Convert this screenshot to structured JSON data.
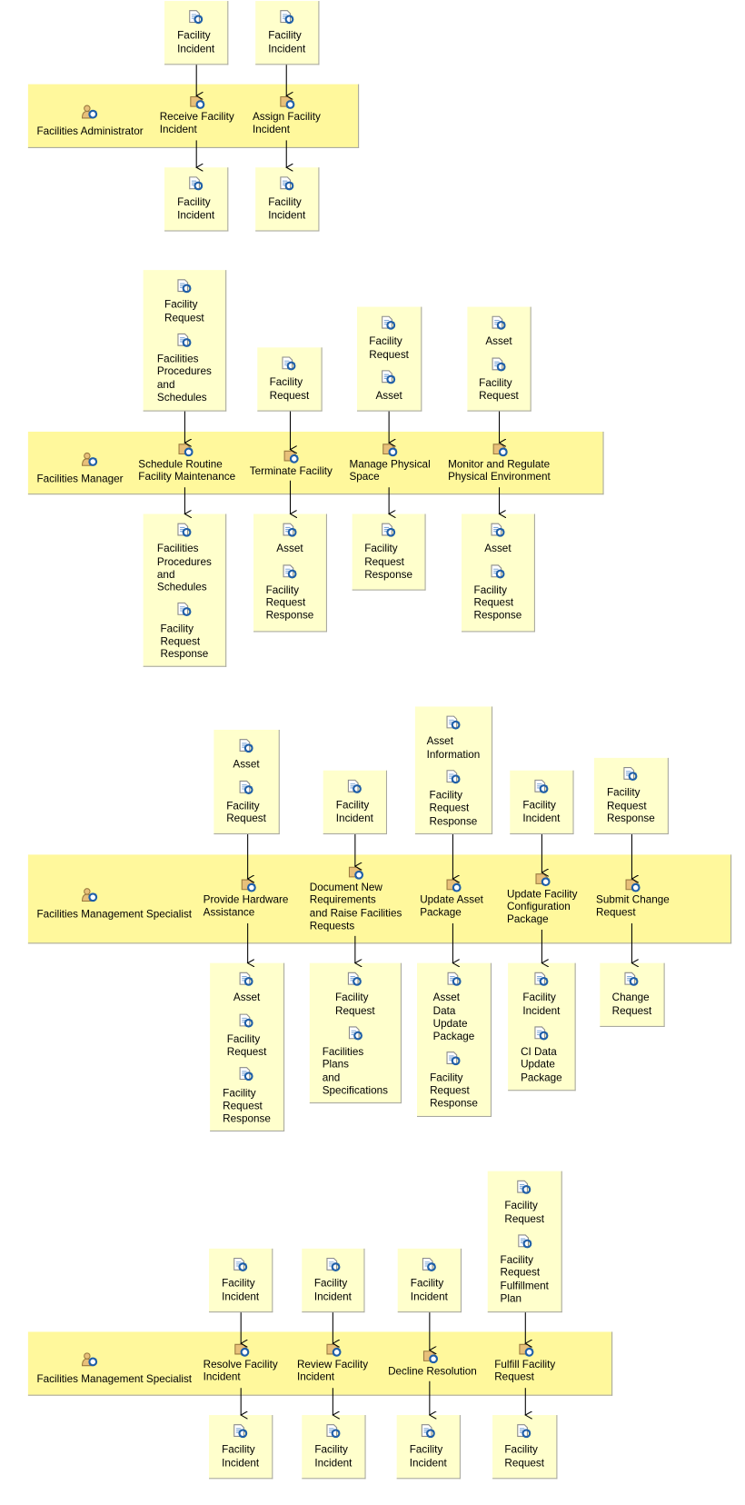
{
  "colors": {
    "lane_fill": "#fff89c",
    "artifact_fill": "#ffffcc",
    "arrow": "#000000",
    "icon_blue": "#1f5fa8",
    "icon_tan": "#e8c07a"
  },
  "icons": {
    "role": "role-person-icon",
    "activity": "activity-task-icon",
    "artifact": "document-artifact-icon"
  },
  "lanes": [
    {
      "role": "Facilities Administrator",
      "activities": [
        {
          "name": "Receive Facility\nIncident",
          "inputs": [
            "Facility\nIncident"
          ],
          "outputs": [
            "Facility\nIncident"
          ]
        },
        {
          "name": "Assign Facility\nIncident",
          "inputs": [
            "Facility\nIncident"
          ],
          "outputs": [
            "Facility\nIncident"
          ]
        }
      ]
    },
    {
      "role": "Facilities Manager",
      "activities": [
        {
          "name": "Schedule Routine\nFacility Maintenance",
          "inputs": [
            "Facility\nRequest",
            "Facilities\nProcedures\nand\nSchedules"
          ],
          "outputs": [
            "Facilities\nProcedures\nand\nSchedules",
            "Facility\nRequest\nResponse"
          ]
        },
        {
          "name": "Terminate Facility",
          "inputs": [
            "Facility\nRequest"
          ],
          "outputs": [
            "Asset",
            "Facility\nRequest\nResponse"
          ]
        },
        {
          "name": "Manage Physical\nSpace",
          "inputs": [
            "Facility\nRequest",
            "Asset"
          ],
          "outputs": [
            "Facility\nRequest\nResponse"
          ]
        },
        {
          "name": "Monitor and Regulate\nPhysical Environment",
          "inputs": [
            "Asset",
            "Facility\nRequest"
          ],
          "outputs": [
            "Asset",
            "Facility\nRequest\nResponse"
          ]
        }
      ]
    },
    {
      "role": "Facilities Management Specialist",
      "activities": [
        {
          "name": "Provide Hardware\nAssistance",
          "inputs": [
            "Asset",
            "Facility\nRequest"
          ],
          "outputs": [
            "Asset",
            "Facility\nRequest",
            "Facility\nRequest\nResponse"
          ]
        },
        {
          "name": "Document New\nRequirements\nand Raise Facilities\nRequests",
          "inputs": [
            "Facility\nIncident"
          ],
          "outputs": [
            "Facility\nRequest",
            "Facilities\nPlans\nand\nSpecifications"
          ]
        },
        {
          "name": "Update Asset\nPackage",
          "inputs": [
            "Asset\nInformation",
            "Facility\nRequest\nResponse"
          ],
          "outputs": [
            "Asset\nData\nUpdate\nPackage",
            "Facility\nRequest\nResponse"
          ]
        },
        {
          "name": "Update Facility\nConfiguration\nPackage",
          "inputs": [
            "Facility\nIncident"
          ],
          "outputs": [
            "Facility\nIncident",
            "CI Data\nUpdate\nPackage"
          ]
        },
        {
          "name": "Submit Change\nRequest",
          "inputs": [
            "Facility\nRequest\nResponse"
          ],
          "outputs": [
            "Change\nRequest"
          ]
        }
      ]
    },
    {
      "role": "Facilities Management Specialist",
      "activities": [
        {
          "name": "Resolve Facility\nIncident",
          "inputs": [
            "Facility\nIncident"
          ],
          "outputs": [
            "Facility\nIncident"
          ]
        },
        {
          "name": "Review Facility\nIncident",
          "inputs": [
            "Facility\nIncident"
          ],
          "outputs": [
            "Facility\nIncident"
          ]
        },
        {
          "name": "Decline Resolution",
          "inputs": [
            "Facility\nIncident"
          ],
          "outputs": [
            "Facility\nIncident"
          ]
        },
        {
          "name": "Fulfill Facility\nRequest",
          "inputs": [
            "Facility\nRequest",
            "Facility\nRequest\nFulfillment\nPlan"
          ],
          "outputs": [
            "Facility\nRequest"
          ]
        }
      ]
    }
  ]
}
